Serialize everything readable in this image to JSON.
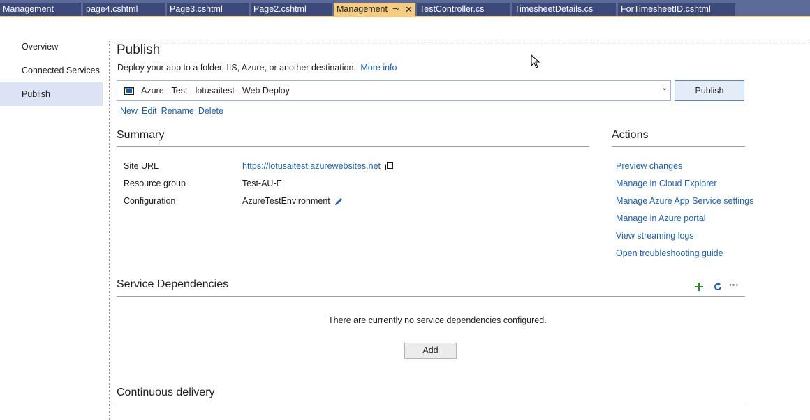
{
  "tabs": [
    {
      "label": "Management"
    },
    {
      "label": "page4.cshtml"
    },
    {
      "label": "Page3.cshtml"
    },
    {
      "label": "Page2.cshtml"
    },
    {
      "label": "Management"
    },
    {
      "label": "TestController.cs"
    },
    {
      "label": "TimesheetDetails.cs"
    },
    {
      "label": "ForTimesheetID.cshtml"
    }
  ],
  "nav": [
    {
      "label": "Overview"
    },
    {
      "label": "Connected Services"
    },
    {
      "label": "Publish"
    }
  ],
  "publish": {
    "title": "Publish",
    "description": "Deploy your app to a folder, IIS, Azure, or another destination.",
    "more_info": "More info",
    "profile": "Azure - Test - lotusaitest - Web Deploy",
    "publish_button": "Publish",
    "actions": [
      "New",
      "Edit",
      "Rename",
      "Delete"
    ]
  },
  "summary": {
    "title": "Summary",
    "rows": [
      {
        "label": "Site URL",
        "value": "https://lotusaitest.azurewebsites.net"
      },
      {
        "label": "Resource group",
        "value": "Test-AU-E"
      },
      {
        "label": "Configuration",
        "value": "AzureTestEnvironment"
      }
    ]
  },
  "actions": {
    "title": "Actions",
    "links": [
      "Preview changes",
      "Manage in Cloud Explorer",
      "Manage Azure App Service settings",
      "Manage in Azure portal",
      "View streaming logs",
      "Open troubleshooting guide"
    ]
  },
  "dependencies": {
    "title": "Service Dependencies",
    "empty_text": "There are currently no service dependencies configured.",
    "add_button": "Add",
    "more": "···"
  },
  "delivery": {
    "title": "Continuous delivery"
  },
  "colors": {
    "tab_bg": "#3b4a7a",
    "active_tab": "#f5cc84",
    "link": "#1a5fb4",
    "nav_selected": "#dbe3f4",
    "add_icon": "#2a8a2a"
  }
}
